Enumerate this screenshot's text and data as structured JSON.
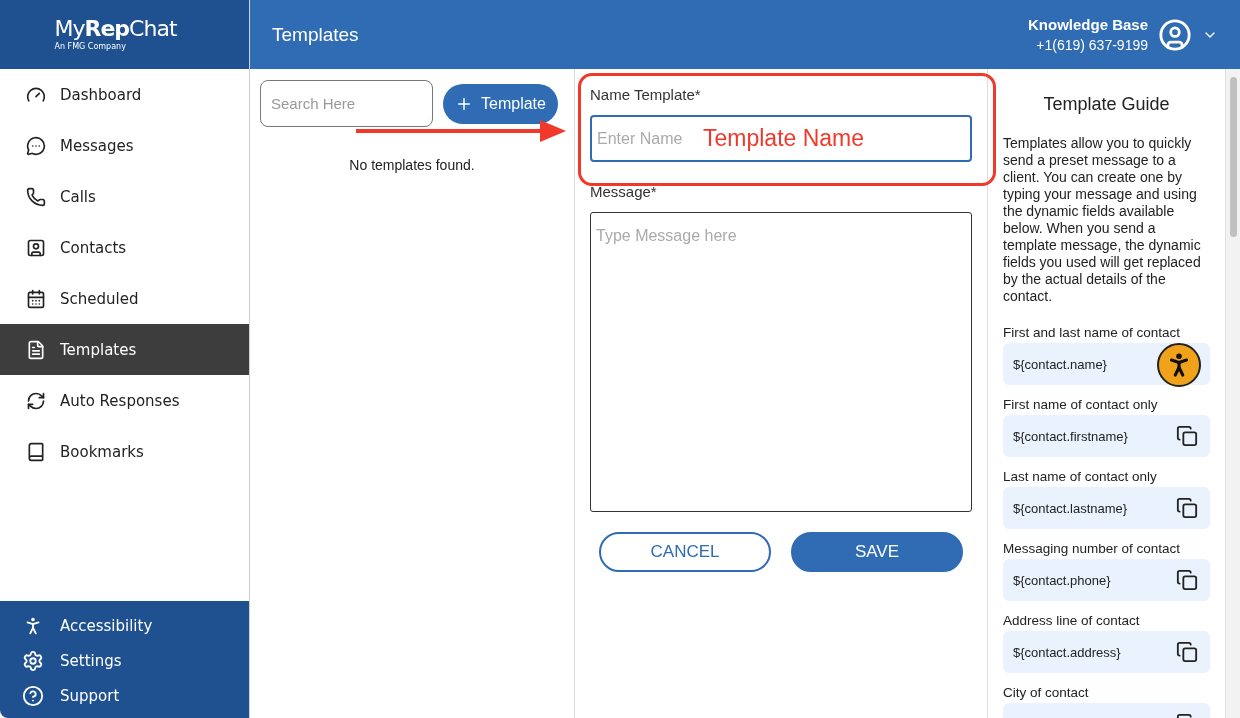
{
  "logo": {
    "name_light": "My",
    "name_bold": "Rep",
    "name_end": "Chat",
    "tagline": "An FMG Company"
  },
  "sidebar": {
    "items": [
      {
        "label": "Dashboard",
        "selected": false
      },
      {
        "label": "Messages",
        "selected": false
      },
      {
        "label": "Calls",
        "selected": false
      },
      {
        "label": "Contacts",
        "selected": false
      },
      {
        "label": "Scheduled",
        "selected": false
      },
      {
        "label": "Templates",
        "selected": true
      },
      {
        "label": "Auto Responses",
        "selected": false
      },
      {
        "label": "Bookmarks",
        "selected": false
      }
    ],
    "footer_items": [
      {
        "label": "Accessibility"
      },
      {
        "label": "Settings"
      },
      {
        "label": "Support"
      }
    ]
  },
  "header": {
    "title": "Templates",
    "account_name": "Knowledge Base",
    "account_phone": "+1(619) 637-9199"
  },
  "template_list": {
    "search_placeholder": "Search Here",
    "add_button": "Template",
    "empty_text": "No templates found."
  },
  "form": {
    "name_label": "Name Template*",
    "name_placeholder": "Enter Name",
    "message_label": "Message*",
    "message_placeholder": "Type Message here",
    "cancel": "CANCEL",
    "save": "SAVE"
  },
  "annotation": {
    "text": "Template Name"
  },
  "guide": {
    "title": "Template Guide",
    "intro": "Templates allow you to quickly send a preset message to a client. You can create one by typing your message and using the dynamic fields available below. When you send a template message, the dynamic fields you used will get replaced by the actual details of the contact.",
    "fields": [
      {
        "label": "First and last name of contact",
        "value": "${contact.name}"
      },
      {
        "label": "First name of contact only",
        "value": "${contact.firstname}"
      },
      {
        "label": "Last name of contact only",
        "value": "${contact.lastname}"
      },
      {
        "label": "Messaging number of contact",
        "value": "${contact.phone}"
      },
      {
        "label": "Address line of contact",
        "value": "${contact.address}"
      },
      {
        "label": "City of contact"
      }
    ]
  }
}
